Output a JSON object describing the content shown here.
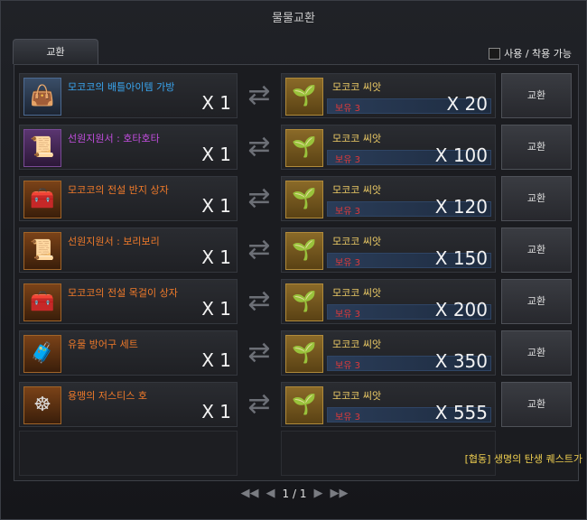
{
  "window": {
    "title": "물물교환"
  },
  "tab": {
    "label": "교환"
  },
  "filter": {
    "label": "사용 / 착용 가능",
    "checked": false
  },
  "rows": [
    {
      "give_name": "모코코의 배틀아이템 가방",
      "give_color": "#3aa6f0",
      "give_qty": "X 1",
      "give_icon": "bag-icon",
      "give_grade": "blue",
      "get_name": "모코코 씨앗",
      "held": "보유 3",
      "get_qty": "X 20",
      "button": "교환"
    },
    {
      "give_name": "선원지원서 : 호타호타",
      "give_color": "#c34ee0",
      "give_qty": "X 1",
      "give_icon": "scroll-icon",
      "give_grade": "purple",
      "get_name": "모코코 씨앗",
      "held": "보유 3",
      "get_qty": "X 100",
      "button": "교환"
    },
    {
      "give_name": "모코코의 전설 반지 상자",
      "give_color": "#f07a2a",
      "give_qty": "X 1",
      "give_icon": "chest-icon",
      "give_grade": "orange",
      "get_name": "모코코 씨앗",
      "held": "보유 3",
      "get_qty": "X 120",
      "button": "교환"
    },
    {
      "give_name": "선원지원서 : 보리보리",
      "give_color": "#f07a2a",
      "give_qty": "X 1",
      "give_icon": "scroll-icon",
      "give_grade": "orange",
      "get_name": "모코코 씨앗",
      "held": "보유 3",
      "get_qty": "X 150",
      "button": "교환"
    },
    {
      "give_name": "모코코의 전설 목걸이 상자",
      "give_color": "#f07a2a",
      "give_qty": "X 1",
      "give_icon": "chest-icon",
      "give_grade": "orange",
      "get_name": "모코코 씨앗",
      "held": "보유 3",
      "get_qty": "X 200",
      "button": "교환"
    },
    {
      "give_name": "유물 방어구 세트",
      "give_color": "#f07a2a",
      "give_qty": "X 1",
      "give_icon": "treasure-chest-icon",
      "give_grade": "orange",
      "get_name": "모코코 씨앗",
      "held": "보유 3",
      "get_qty": "X 350",
      "button": "교환"
    },
    {
      "give_name": "용맹의 저스티스 호",
      "give_color": "#f07a2a",
      "give_qty": "X 1",
      "give_icon": "ship-wheel-icon",
      "give_grade": "orange",
      "get_name": "모코코 씨앗",
      "held": "보유 3",
      "get_qty": "X 555",
      "button": "교환"
    }
  ],
  "quest_link": "[협동] 생명의 탄생 퀘스트가",
  "pager": {
    "first": "◀◀",
    "prev": "◀",
    "page": "1 / 1",
    "next": "▶",
    "last": "▶▶"
  }
}
